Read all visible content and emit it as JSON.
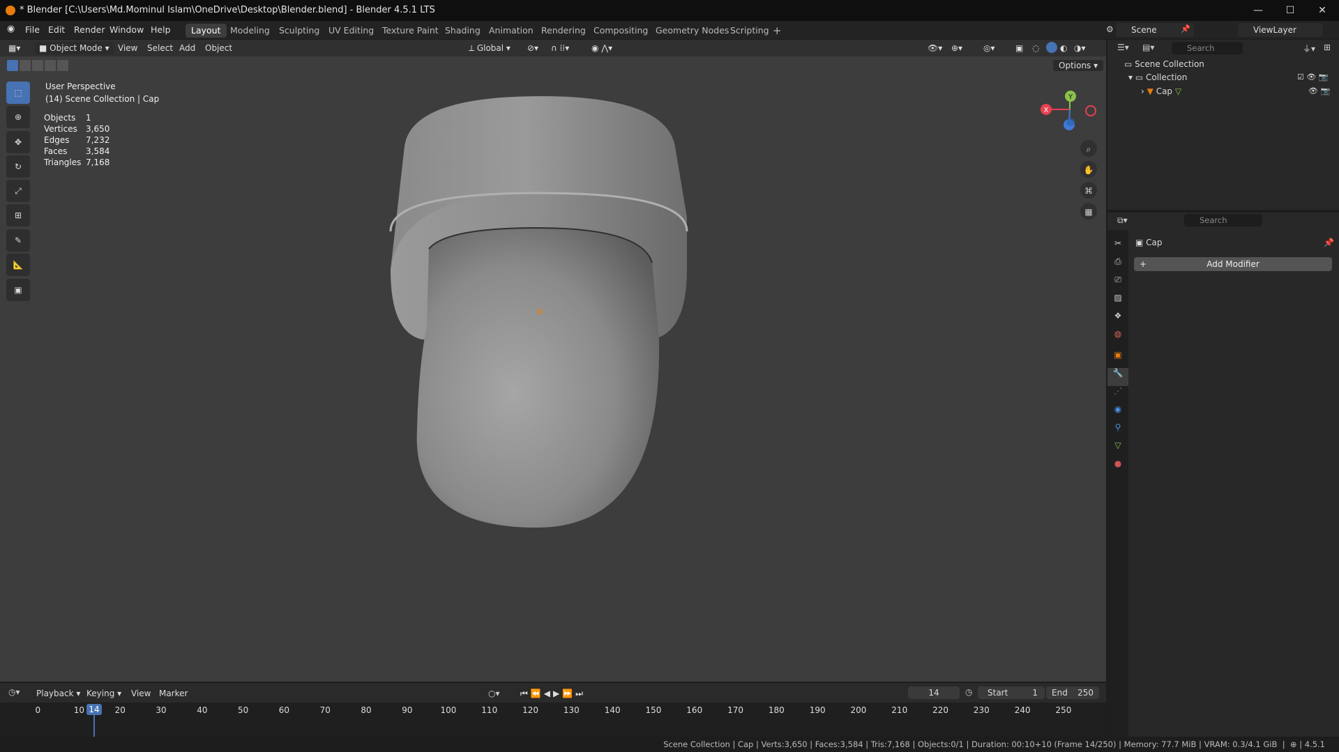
{
  "window": {
    "title": "* Blender [C:\\Users\\Md.Mominul Islam\\OneDrive\\Desktop\\Blender.blend] - Blender 4.5.1 LTS"
  },
  "menu": [
    "File",
    "Edit",
    "Render",
    "Window",
    "Help"
  ],
  "workspaces": [
    "Layout",
    "Modeling",
    "Sculpting",
    "UV Editing",
    "Texture Paint",
    "Shading",
    "Animation",
    "Rendering",
    "Compositing",
    "Geometry Nodes",
    "Scripting"
  ],
  "active_workspace": "Layout",
  "scene": {
    "name": "Scene",
    "view_layer": "ViewLayer"
  },
  "viewport_header": {
    "mode": "Object Mode",
    "menus": [
      "View",
      "Select",
      "Add",
      "Object"
    ],
    "orientation": "Global",
    "options_label": "Options"
  },
  "overlay_info": {
    "perspective": "User Perspective",
    "context": "(14) Scene Collection | Cap",
    "stats": [
      {
        "label": "Objects",
        "value": "1"
      },
      {
        "label": "Vertices",
        "value": "3,650"
      },
      {
        "label": "Edges",
        "value": "7,232"
      },
      {
        "label": "Faces",
        "value": "3,584"
      },
      {
        "label": "Triangles",
        "value": "7,168"
      }
    ]
  },
  "outliner": {
    "search_placeholder": "Search",
    "root": "Scene Collection",
    "collection": "Collection",
    "object": "Cap"
  },
  "properties": {
    "search_placeholder": "Search",
    "object_name": "Cap",
    "add_modifier": "Add Modifier"
  },
  "timeline": {
    "menus": [
      "Playback",
      "Keying",
      "View",
      "Marker"
    ],
    "current_frame": "14",
    "start_label": "Start",
    "start": "1",
    "end_label": "End",
    "end": "250",
    "ticks": [
      "0",
      "10",
      "20",
      "30",
      "40",
      "50",
      "60",
      "70",
      "80",
      "90",
      "100",
      "110",
      "120",
      "130",
      "140",
      "150",
      "160",
      "170",
      "180",
      "190",
      "200",
      "210",
      "220",
      "230",
      "240",
      "250"
    ]
  },
  "status_bar": {
    "text": "Scene Collection | Cap | Verts:3,650 | Faces:3,584 | Tris:7,168 | Objects:0/1 | Duration: 00:10+10 (Frame 14/250) | Memory: 77.7 MiB | VRAM: 0.3/4.1 GiB",
    "version": "4.5.1"
  },
  "colors": {
    "accent": "#4772b3",
    "origin": "#e87d0d",
    "axis_x": "#e8414f",
    "axis_y": "#8bc34a",
    "axis_z": "#3e7ad6"
  }
}
